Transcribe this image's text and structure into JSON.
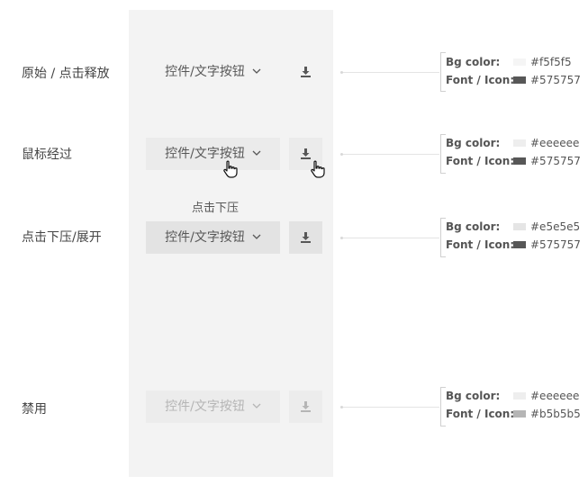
{
  "states": [
    {
      "label": "原始 / 点击释放",
      "button_text": "控件/文字按钮",
      "bg": "#f5f5f5",
      "fg": "#575757",
      "spec": {
        "bg_key": "Bg color:",
        "bg_value": "#f5f5f5",
        "font_key": "Font / Icon:",
        "font_value": "#575757"
      }
    },
    {
      "label": "鼠标经过",
      "button_text": "控件/文字按钮",
      "bg": "#eeeeee",
      "fg": "#575757",
      "spec": {
        "bg_key": "Bg color:",
        "bg_value": "#eeeeee",
        "font_key": "Font / Icon:",
        "font_value": "#575757"
      }
    },
    {
      "label": "点击下压/展开",
      "button_text": "控件/文字按钮",
      "caption": "点击下压",
      "bg": "#e5e5e5",
      "fg": "#575757",
      "spec": {
        "bg_key": "Bg color:",
        "bg_value": "#e5e5e5",
        "font_key": "Font / Icon:",
        "font_value": "#575757"
      }
    },
    {
      "label": "禁用",
      "button_text": "控件/文字按钮",
      "bg": "#eeeeee",
      "fg": "#b5b5b5",
      "spec": {
        "bg_key": "Bg color:",
        "bg_value": "#eeeeee",
        "font_key": "Font / Icon:",
        "font_value": "#b5b5b5"
      }
    }
  ],
  "icons": {
    "dropdown": "chevron-down-icon",
    "action": "download-icon",
    "cursor": "hand-pointer-icon"
  }
}
